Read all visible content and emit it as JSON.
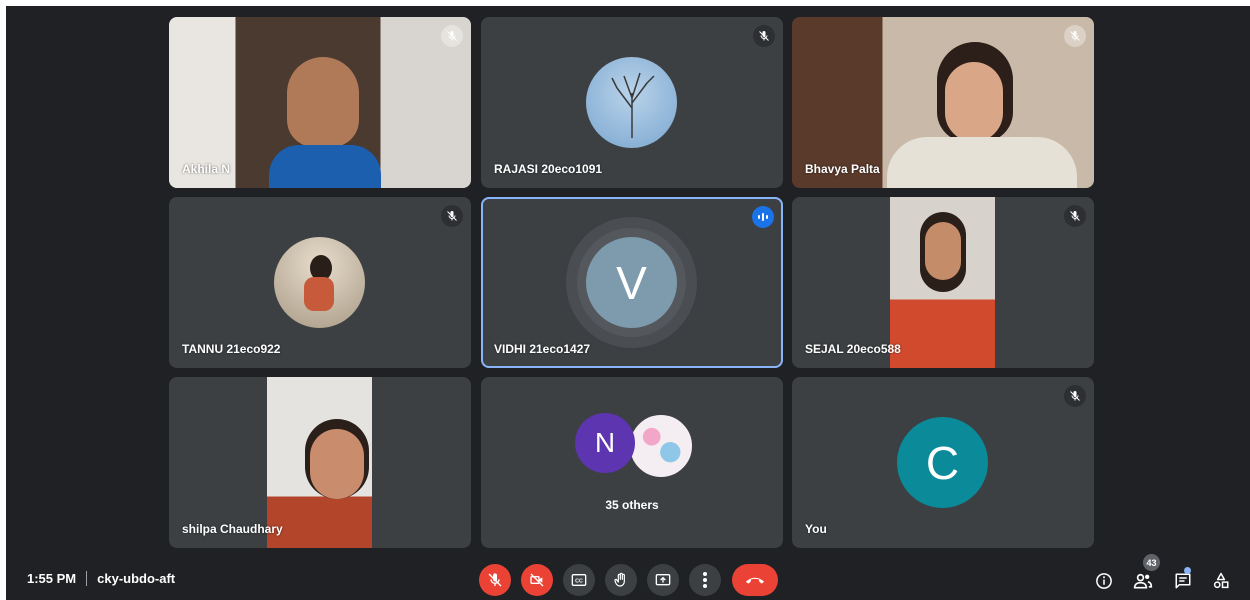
{
  "participants": [
    {
      "name": "Akhila N"
    },
    {
      "name": "RAJASI 20eco1091"
    },
    {
      "name": "Bhavya Palta"
    },
    {
      "name": "TANNU 21eco922"
    },
    {
      "name": "VIDHI 21eco1427",
      "initial": "V"
    },
    {
      "name": "SEJAL 20eco588"
    },
    {
      "name": "shilpa Chaudhary"
    },
    {
      "name": "35 others",
      "initial": "N"
    },
    {
      "name": "You",
      "initial": "C"
    }
  ],
  "meeting": {
    "time": "1:55 PM",
    "code": "cky-ubdo-aft"
  },
  "people_count": "43",
  "colors": {
    "tile": "#3c4043",
    "background": "#202124",
    "danger": "#ea4335",
    "active_border": "#8ab4f8",
    "speaking": "#1a73e8"
  }
}
